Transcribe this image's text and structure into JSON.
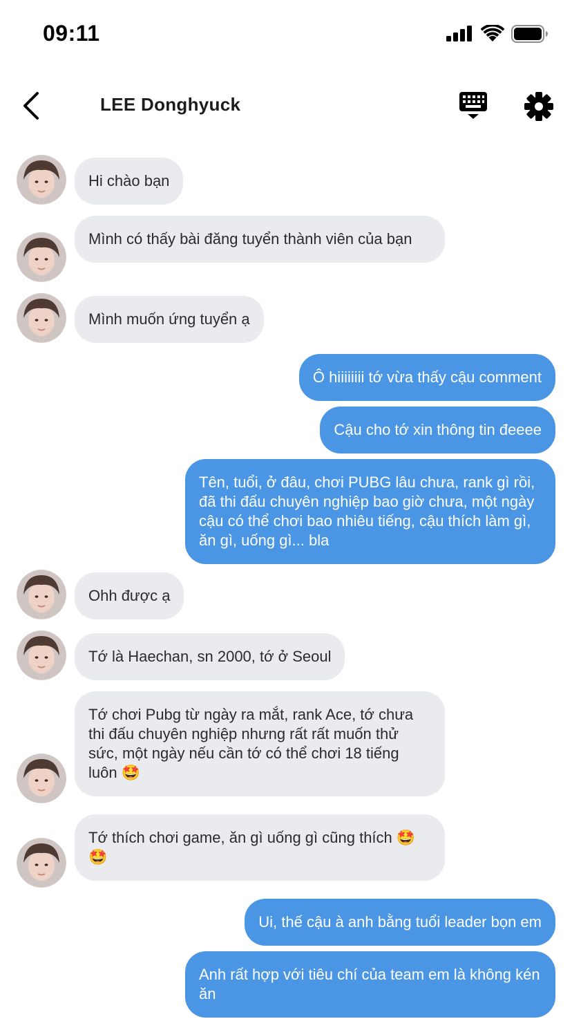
{
  "status_bar": {
    "time": "09:11"
  },
  "header": {
    "title": "LEE Donghyuck"
  },
  "colors": {
    "incoming_bubble": "#e9ebef",
    "outgoing_bubble": "#4a96e5",
    "text": "#1c1c1e"
  },
  "icons": {
    "back": "chevron-left-icon",
    "keyboard": "keyboard-icon",
    "settings": "gear-icon"
  },
  "messages": [
    {
      "from": "them",
      "text": "Hi chào bạn"
    },
    {
      "from": "them",
      "text": "Mình có thấy bài đăng tuyển thành viên của bạn"
    },
    {
      "from": "them",
      "text": "Mình muốn ứng tuyển ạ"
    },
    {
      "from": "me",
      "text": "Ô hiiiiiiii tớ vừa thấy cậu comment"
    },
    {
      "from": "me",
      "text": "Cậu cho tớ xin thông tin đeeee"
    },
    {
      "from": "me",
      "text": "Tên, tuổi, ở đâu, chơi PUBG lâu chưa, rank gì rồi, đã thi đấu chuyên nghiệp bao giờ chưa, một ngày cậu có thể chơi bao nhiêu tiếng, cậu thích làm gì, ăn gì, uống gì... bla"
    },
    {
      "from": "them",
      "text": "Ohh được ạ"
    },
    {
      "from": "them",
      "text": "Tớ là Haechan, sn 2000, tớ ở Seoul"
    },
    {
      "from": "them",
      "text": "Tớ chơi Pubg từ ngày ra mắt, rank Ace, tớ chưa thi đấu chuyên nghiệp nhưng rất rất muốn thử sức, một ngày nếu cần tớ có thể chơi 18 tiếng luôn 🤩"
    },
    {
      "from": "them",
      "text": "Tớ thích chơi game, ăn gì uống gì cũng thích 🤩🤩"
    },
    {
      "from": "me",
      "text": "Ui, thế cậu à anh bằng tuổi leader bọn em"
    },
    {
      "from": "me",
      "text": "Anh rất hợp với tiêu chí của team em là không kén ăn"
    }
  ]
}
